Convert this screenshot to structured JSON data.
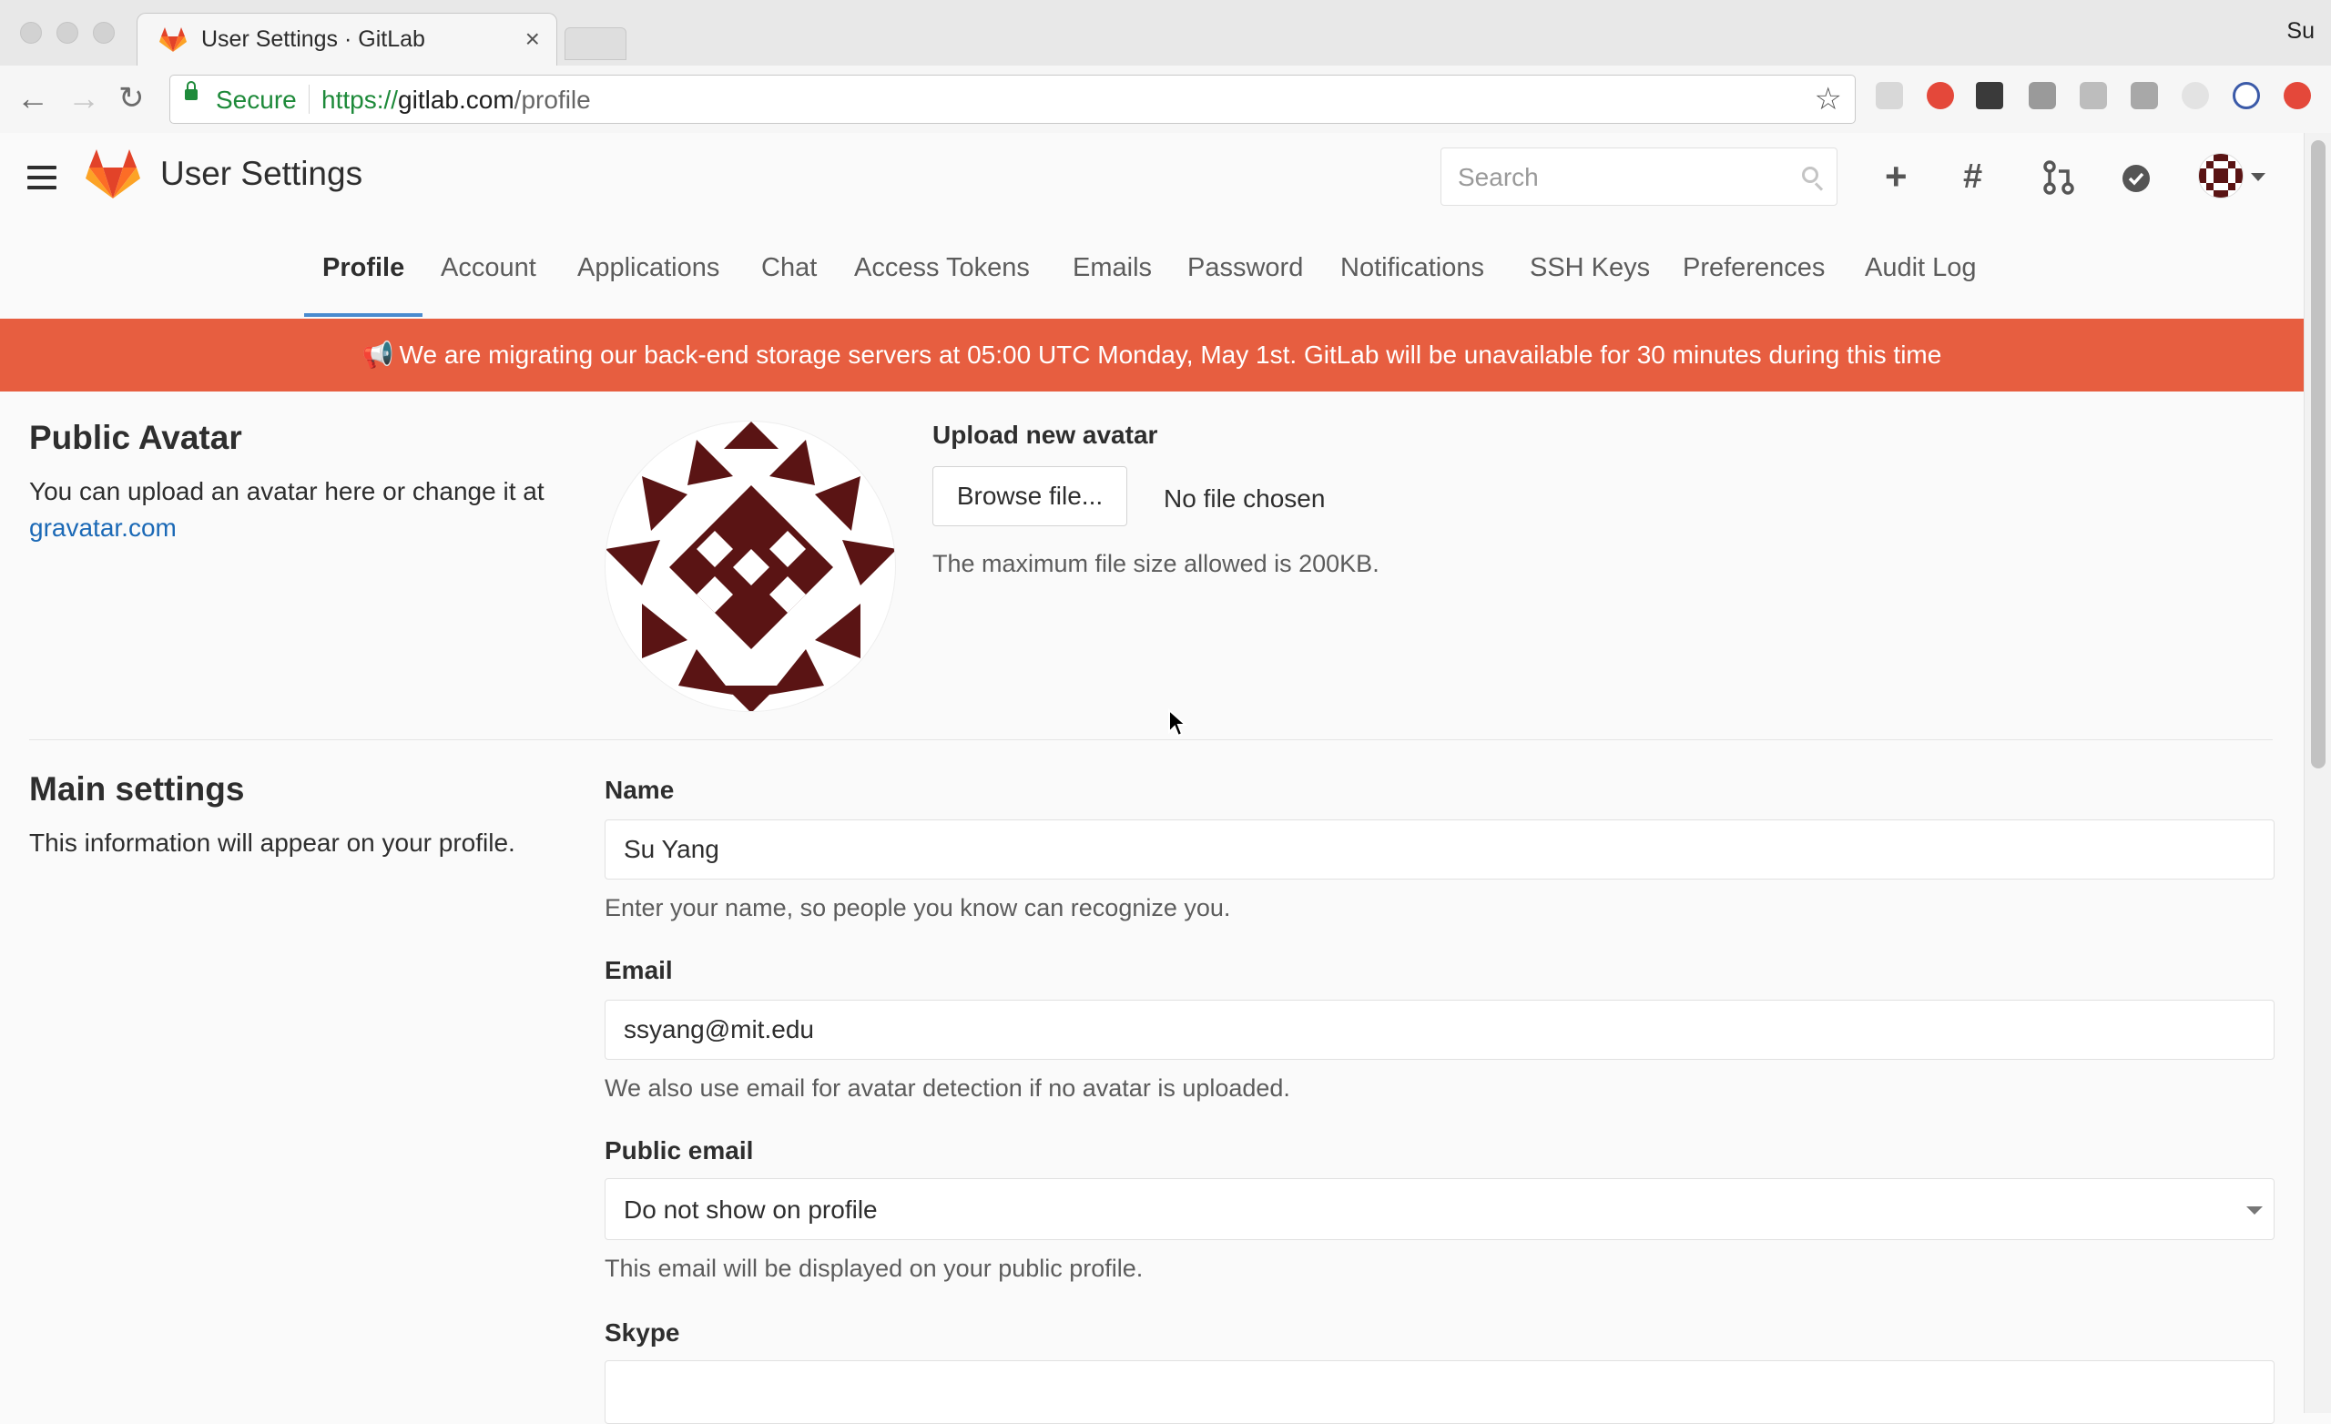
{
  "browser": {
    "tab_title": "User Settings · GitLab",
    "tab_close": "×",
    "profile_name": "Su",
    "secure_label": "Secure",
    "url_scheme": "https://",
    "url_host": "gitlab.com",
    "url_path": "/profile"
  },
  "header": {
    "title": "User Settings",
    "search_placeholder": "Search",
    "icons": [
      "plus-icon",
      "hash-icon",
      "merge-request-icon",
      "todo-check-icon"
    ]
  },
  "subnav": {
    "items": [
      "Profile",
      "Account",
      "Applications",
      "Chat",
      "Access Tokens",
      "Emails",
      "Password",
      "Notifications",
      "SSH Keys",
      "Preferences",
      "Audit Log"
    ],
    "active": "Profile"
  },
  "banner": {
    "text": "We are migrating our back-end storage servers at 05:00 UTC Monday, May 1st. GitLab will be unavailable for 30 minutes during this time",
    "color": "#e75e40"
  },
  "avatar_section": {
    "title": "Public Avatar",
    "desc_prefix": "You can upload an avatar here or change it at",
    "desc_link": "gravatar.com",
    "upload_label": "Upload new avatar",
    "browse_button": "Browse file...",
    "no_file": "No file chosen",
    "max_size_hint": "The maximum file size allowed is 200KB."
  },
  "main_settings": {
    "title": "Main settings",
    "desc": "This information will appear on your profile.",
    "name_label": "Name",
    "name_value": "Su Yang",
    "name_hint": "Enter your name, so people you know can recognize you.",
    "email_label": "Email",
    "email_value": "ssyang@mit.edu",
    "email_hint": "We also use email for avatar detection if no avatar is uploaded.",
    "public_email_label": "Public email",
    "public_email_value": "Do not show on profile",
    "public_email_hint": "This email will be displayed on your public profile.",
    "skype_label": "Skype",
    "skype_value": ""
  },
  "colors": {
    "accent": "#4a8bcf",
    "link": "#1b69b6",
    "secure_green": "#1e8a3a",
    "identicon": "#5a1414"
  }
}
